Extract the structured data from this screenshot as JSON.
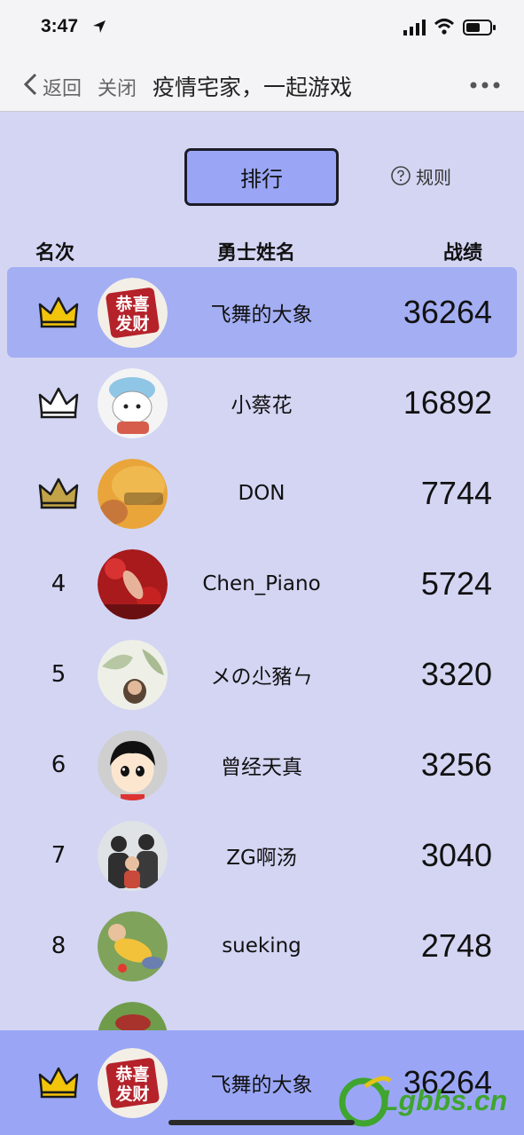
{
  "status_bar": {
    "time": "3:47"
  },
  "nav": {
    "back_label": "返回",
    "close_label": "关闭",
    "title": "疫情宅家，一起游戏"
  },
  "tabs": {
    "rank_label": "排行",
    "rules_label": "规则"
  },
  "columns": {
    "rank": "名次",
    "name": "勇士姓名",
    "score": "战绩"
  },
  "rows": [
    {
      "rank": "",
      "crown": "gold",
      "name": "飞舞的大象",
      "score": "36264",
      "avatar": "gongxi-facai-avatar"
    },
    {
      "rank": "",
      "crown": "silver",
      "name": "小蔡花",
      "score": "16892",
      "avatar": "cartoon-hat-avatar"
    },
    {
      "rank": "",
      "crown": "bronze",
      "name": "DON",
      "score": "7744",
      "avatar": "orange-toy-avatar"
    },
    {
      "rank": "4",
      "crown": "",
      "name": "Chen_Piano",
      "score": "5724",
      "avatar": "red-flowers-avatar"
    },
    {
      "rank": "5",
      "crown": "",
      "name": "メの尐豬ㄣ",
      "score": "3320",
      "avatar": "girl-leaves-avatar"
    },
    {
      "rank": "6",
      "crown": "",
      "name": "曾经天真",
      "score": "3256",
      "avatar": "cartoon-face-avatar"
    },
    {
      "rank": "7",
      "crown": "",
      "name": "ZG啊汤",
      "score": "3040",
      "avatar": "family-photo-avatar"
    },
    {
      "rank": "8",
      "crown": "",
      "name": "sueking",
      "score": "2748",
      "avatar": "child-grass-avatar"
    }
  ],
  "my_rank": {
    "crown": "gold",
    "name": "飞舞的大象",
    "score": "36264"
  },
  "watermark": {
    "text": "Lgbbs.cn"
  },
  "colors": {
    "background": "#d3d5f3",
    "highlight": "#a3aef3",
    "tab": "#9aa6f5",
    "gold": "#f2c40a",
    "silver": "#ffffff",
    "bronze": "#c2a347"
  }
}
